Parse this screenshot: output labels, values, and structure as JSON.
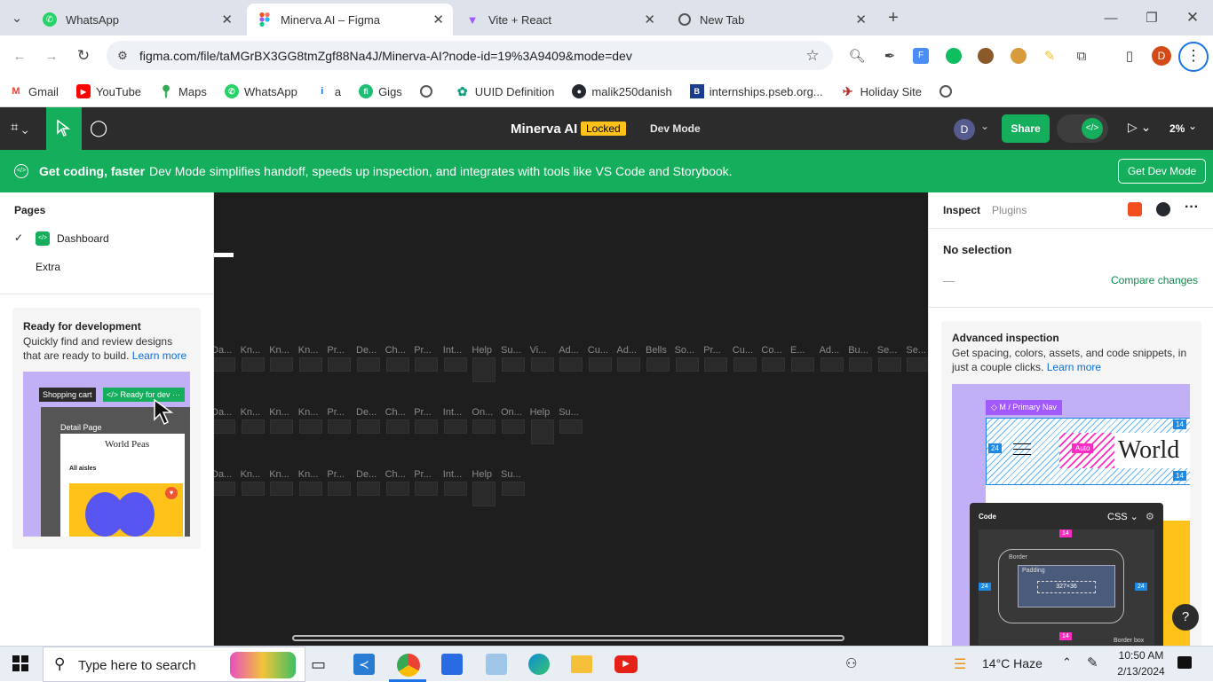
{
  "browser": {
    "tabs": [
      {
        "title": "WhatsApp",
        "icon": "whatsapp-icon"
      },
      {
        "title": "Minerva AI – Figma",
        "icon": "figma-icon"
      },
      {
        "title": "Vite + React",
        "icon": "vite-icon"
      },
      {
        "title": "New Tab",
        "icon": "chrome-icon"
      }
    ],
    "url": "figma.com/file/taMGrBX3GG8tmZgf88Na4J/Minerva-AI?node-id=19%3A9409&mode=dev",
    "profile_initial": "D",
    "bookmarks": [
      {
        "label": "Gmail",
        "color": "#ea4335"
      },
      {
        "label": "YouTube",
        "color": "#ff0000"
      },
      {
        "label": "Maps",
        "color": "#34a853"
      },
      {
        "label": "WhatsApp",
        "color": "#25d366"
      },
      {
        "label": "a",
        "color": "#1a73e8"
      },
      {
        "label": "Gigs",
        "color": "#1dbf73"
      },
      {
        "label": "",
        "color": "#555555"
      },
      {
        "label": "UUID Definition",
        "color": "#10a37f"
      },
      {
        "label": "malik250danish",
        "color": "#24292f"
      },
      {
        "label": "internships.pseb.org...",
        "color": "#1a3d8f"
      },
      {
        "label": "Holiday Site",
        "color": "#b5312f"
      },
      {
        "label": "",
        "color": "#555555"
      }
    ]
  },
  "figma": {
    "file_name": "Minerva AI",
    "locked_label": "Locked",
    "mode_label": "Dev Mode",
    "avatar_initial": "D",
    "share_label": "Share",
    "zoom_label": "2%",
    "banner": {
      "title": "Get coding, faster",
      "text": "Dev Mode simplifies handoff, speeds up inspection, and integrates with tools like VS Code and Storybook.",
      "button": "Get Dev Mode"
    },
    "pages": {
      "heading": "Pages",
      "items": [
        "Dashboard",
        "Extra"
      ]
    },
    "ready_card": {
      "title": "Ready for development",
      "text": "Quickly find and review designs that are ready to build.",
      "link": "Learn more",
      "illus_tag1": "Shopping cart",
      "illus_tag2": "Ready for dev",
      "illus_page": "Detail Page",
      "illus_brand": "World Peas",
      "illus_back": "All aisles"
    },
    "inspect": {
      "tab_inspect": "Inspect",
      "tab_plugins": "Plugins",
      "no_selection": "No selection",
      "dash": "—",
      "compare": "Compare changes",
      "adv_title": "Advanced inspection",
      "adv_text": "Get spacing, colors, assets, and code snippets, in just a couple clicks.",
      "adv_link": "Learn more",
      "nav_tag": "M / Primary Nav",
      "nav_brand": "World",
      "auto": "Auto",
      "code_label": "Code",
      "css_label": "CSS",
      "border_label": "Border",
      "padding_label": "Padding",
      "size_label": "327×36",
      "box_label": "Border box",
      "help": "?"
    },
    "canvas_rows": [
      [
        "Da...",
        "Kn...",
        "Kn...",
        "Kn...",
        "Pr...",
        "De...",
        "Ch...",
        "Pr...",
        "Int...",
        "Help",
        "Su...",
        "Vi...",
        "Ad...",
        "Cu...",
        "Ad...",
        "Bells",
        "So...",
        "Pr...",
        "Cu...",
        "Co...",
        "E...",
        "Ad...",
        "Bu...",
        "Se...",
        "Se..."
      ],
      [
        "Da...",
        "Kn...",
        "Kn...",
        "Kn...",
        "Pr...",
        "De...",
        "Ch...",
        "Pr...",
        "Int...",
        "On...",
        "On...",
        "Help",
        "Su..."
      ],
      [
        "Da...",
        "Kn...",
        "Kn...",
        "Kn...",
        "Pr...",
        "De...",
        "Ch...",
        "Pr...",
        "Int...",
        "Help",
        "Su..."
      ]
    ]
  },
  "taskbar": {
    "search_placeholder": "Type here to search",
    "weather": "14°C  Haze",
    "time": "10:50 AM",
    "date": "2/13/2024"
  }
}
